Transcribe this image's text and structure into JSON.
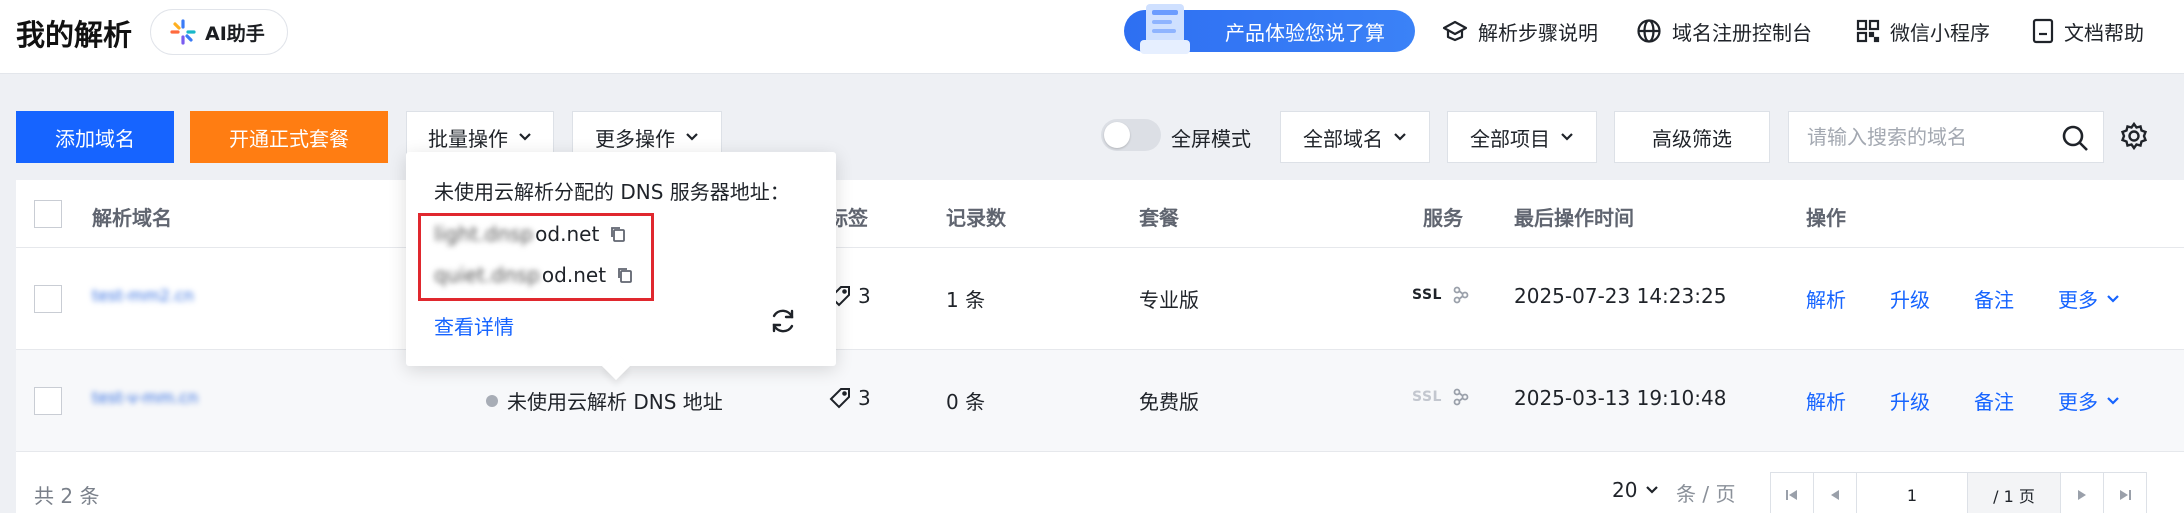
{
  "header": {
    "title": "我的解析",
    "ai_label": "AI助手",
    "promo_label": "产品体验您说了算",
    "links": [
      "解析步骤说明",
      "域名注册控制台",
      "微信小程序",
      "文档帮助"
    ]
  },
  "toolbar": {
    "add_domain": "添加域名",
    "open_package": "开通正式套餐",
    "batch_ops": "批量操作",
    "more_ops": "更多操作",
    "fullscreen_label": "全屏模式",
    "all_domains": "全部域名",
    "all_projects": "全部项目",
    "advanced_filter": "高级筛选",
    "search_placeholder": "请输入搜索的域名"
  },
  "table": {
    "headers": {
      "domain": "解析域名",
      "tag": "标签",
      "records": "记录数",
      "package": "套餐",
      "service": "服务",
      "last_time": "最后操作时间",
      "actions": "操作"
    },
    "rows": [
      {
        "domain": "test-mm2.cn",
        "status": "",
        "tag_count": "3",
        "records": "1 条",
        "package": "专业版",
        "ssl": "SSL",
        "ssl_active": true,
        "time": "2025-07-23 14:23:25",
        "actions": [
          "解析",
          "升级",
          "备注",
          "更多"
        ]
      },
      {
        "domain": "test-v-mm.cn",
        "status": "未使用云解析 DNS 地址",
        "tag_count": "3",
        "records": "0 条",
        "package": "免费版",
        "ssl": "SSL",
        "ssl_active": false,
        "time": "2025-03-13 19:10:48",
        "actions": [
          "解析",
          "升级",
          "备注",
          "更多"
        ]
      }
    ]
  },
  "footer": {
    "total": "共 2 条",
    "page_size": "20",
    "per_page_unit": "条 / 页",
    "current_page": "1",
    "total_pages": "/ 1 页"
  },
  "popover": {
    "title": "未使用云解析分配的 DNS 服务器地址：",
    "ns1_prefix": "light.dnsp",
    "ns1_suffix": "od.net",
    "ns2_prefix": "quiet.dnsp",
    "ns2_suffix": "od.net",
    "detail_link": "查看详情"
  },
  "colors": {
    "primary": "#1664ff",
    "orange": "#ff7d12",
    "highlight_red": "#e0282e"
  }
}
